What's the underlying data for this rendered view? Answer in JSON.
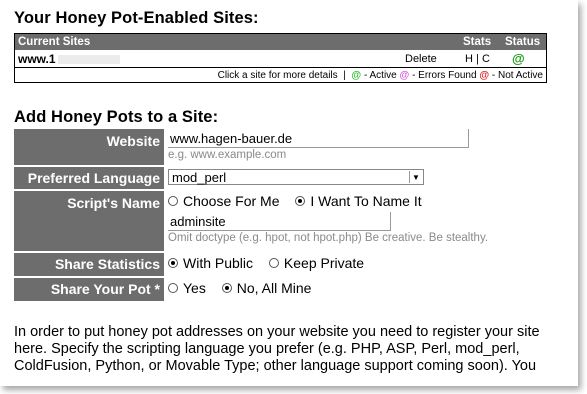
{
  "sites_section": {
    "title": "Your Honey Pot-Enabled Sites:",
    "columns": [
      "Current Sites",
      "Stats",
      "Status"
    ],
    "rows": [
      {
        "site": "www.1",
        "delete": "Delete",
        "h": "H",
        "sep": "|",
        "c": "C",
        "status_icon": "@"
      }
    ],
    "legend": {
      "prefix": "Click a site for more details",
      "sep1": "|",
      "active_icon": "@",
      "active_label": "- Active",
      "errors_icon": "@",
      "errors_label": "- Errors Found",
      "inactive_icon": "@",
      "inactive_label": "- Not Active"
    }
  },
  "add_section": {
    "title": "Add Honey Pots to a Site:",
    "website": {
      "label": "Website",
      "value": "www.hagen-bauer.de",
      "hint": "e.g. www.example.com"
    },
    "language": {
      "label": "Preferred Language",
      "value": "mod_perl"
    },
    "script_name": {
      "label": "Script's Name",
      "option_auto": "Choose For Me",
      "option_manual": "I Want To Name It",
      "value": "adminsite",
      "hint": "Omit doctype (e.g. hpot, not hpot.php) Be creative. Be stealthy."
    },
    "share_stats": {
      "label": "Share Statistics",
      "option_public": "With Public",
      "option_private": "Keep Private"
    },
    "share_pot": {
      "label": "Share Your Pot *",
      "option_yes": "Yes",
      "option_no": "No, All Mine"
    }
  },
  "instructions": "In order to put honey pot addresses on your website you need to register your site here. Specify the scripting language you prefer (e.g. PHP, ASP, Perl, mod_perl, ColdFusion, Python, or Movable Type; other language support coming soon). You",
  "colors": {
    "header_bg": "#6d6d6d",
    "active": "#2fbf2f",
    "errors": "#d85fd8",
    "inactive": "#dd2222"
  }
}
